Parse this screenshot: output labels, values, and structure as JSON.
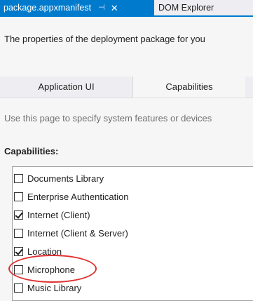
{
  "tabs": [
    {
      "label": "package.appxmanifest",
      "active": true,
      "pin_icon": "pin-icon",
      "close_icon": "close-icon",
      "pin_glyph": "⊣",
      "close_glyph": "✕"
    },
    {
      "label": "DOM Explorer",
      "active": false
    }
  ],
  "page": {
    "description": "The properties of the deployment package for you",
    "pivot": [
      {
        "label": "Application UI",
        "selected": false
      },
      {
        "label": "Capabilities",
        "selected": true
      }
    ],
    "hint": "Use this page to specify system features or devices",
    "capabilities_heading": "Capabilities:",
    "capabilities": [
      {
        "label": "Documents Library",
        "checked": false
      },
      {
        "label": "Enterprise Authentication",
        "checked": false
      },
      {
        "label": "Internet (Client)",
        "checked": true
      },
      {
        "label": "Internet (Client & Server)",
        "checked": false
      },
      {
        "label": "Location",
        "checked": true,
        "highlighted": true
      },
      {
        "label": "Microphone",
        "checked": false
      },
      {
        "label": "Music Library",
        "checked": false
      }
    ]
  },
  "colors": {
    "accent": "#007acc",
    "highlight_ring": "#e03030"
  }
}
